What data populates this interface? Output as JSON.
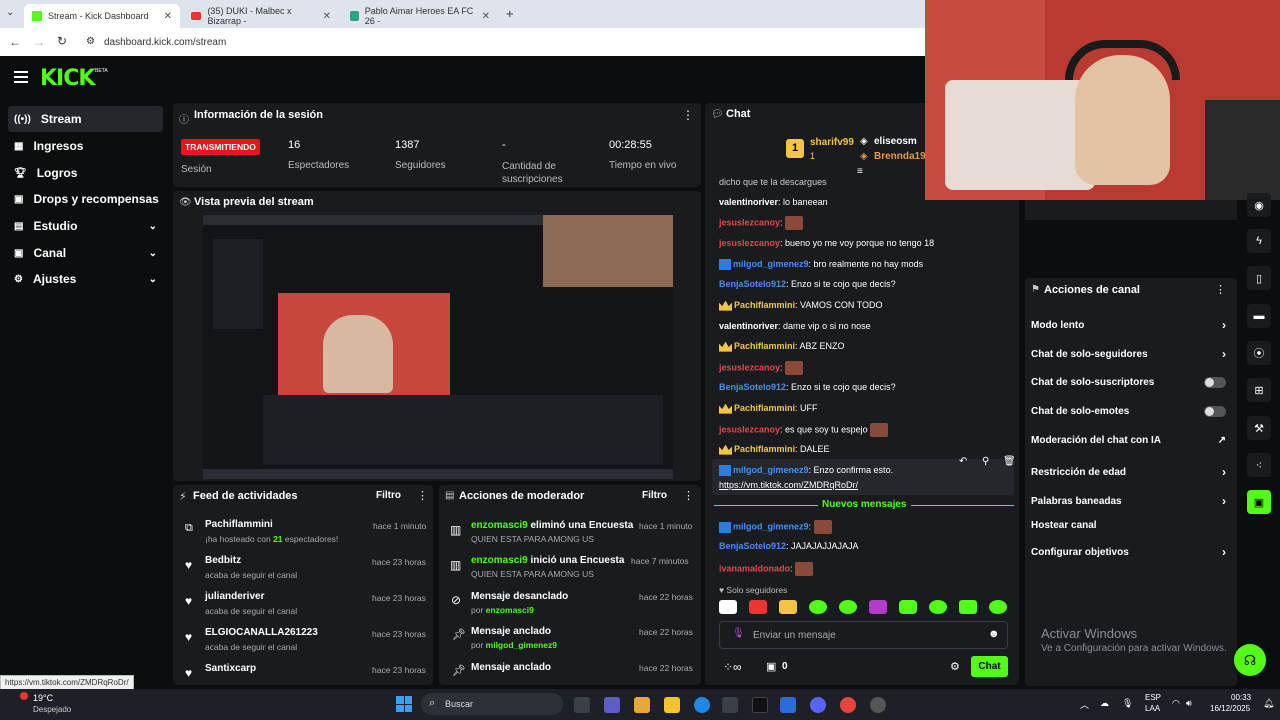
{
  "browser": {
    "tabs": [
      {
        "title": "Stream - Kick Dashboard",
        "active": true
      },
      {
        "title": "(35) DUKI - Malbec x Bizarrap -",
        "active": false
      },
      {
        "title": "Pablo Aimar Heroes EA FC 26 -",
        "active": false
      }
    ],
    "url": "dashboard.kick.com/stream",
    "status_url": "https://vm.tiktok.com/ZMDRqRoDr/"
  },
  "header": {
    "logo": "KICK",
    "beta": "BETA"
  },
  "sidebar": {
    "items": [
      {
        "label": "Stream",
        "active": true,
        "icon": "broadcast-icon"
      },
      {
        "label": "Ingresos",
        "icon": "chart-icon"
      },
      {
        "label": "Logros",
        "icon": "trophy-icon"
      },
      {
        "label": "Drops y recompensas",
        "icon": "gift-icon"
      },
      {
        "label": "Estudio",
        "icon": "studio-icon",
        "chevron": "⌄"
      },
      {
        "label": "Canal",
        "icon": "channel-icon",
        "chevron": "⌄"
      },
      {
        "label": "Ajustes",
        "icon": "gear-icon",
        "chevron": "⌄"
      }
    ]
  },
  "session": {
    "title": "Información de la sesión",
    "live_badge": "TRANSMITIENDO",
    "session_label": "Sesión",
    "stats": [
      {
        "value": "16",
        "label": "Espectadores"
      },
      {
        "value": "1387",
        "label": "Seguidores"
      },
      {
        "value": "-",
        "label": "Cantidad de suscripciones"
      },
      {
        "value": "00:28:55",
        "label": "Tiempo en vivo"
      }
    ]
  },
  "preview": {
    "title": "Vista previa del stream"
  },
  "feed": {
    "title": "Feed de actividades",
    "filter": "Filtro",
    "items": [
      {
        "name": "Pachiflammini",
        "sub_pre": "¡ha hosteado con ",
        "sub_num": "21",
        "sub_post": " espectadores!",
        "time": "hace 1 minuto",
        "icon": "host-icon"
      },
      {
        "name": "Bedbitz",
        "sub": "acaba de seguir el canal",
        "time": "hace 23 horas",
        "icon": "heart-icon"
      },
      {
        "name": "julianderiver",
        "sub": "acaba de seguir el canal",
        "time": "hace 23 horas",
        "icon": "heart-icon"
      },
      {
        "name": "ELGIOCANALLA261223",
        "sub": "acaba de seguir el canal",
        "time": "hace 23 horas",
        "icon": "heart-icon"
      },
      {
        "name": "Santixcarp",
        "sub": "",
        "time": "hace 23 horas",
        "icon": "heart-icon"
      }
    ]
  },
  "modactions": {
    "title": "Acciones de moderador",
    "filter": "Filtro",
    "items": [
      {
        "user": "enzomasci9",
        "action": " eliminó una Encuesta",
        "sub": "QUIEN ESTA PARA AMONG US",
        "time": "hace 1 minuto",
        "icon": "poll-icon"
      },
      {
        "user": "enzomasci9",
        "action": " inició una Encuesta",
        "sub": "QUIEN ESTA PARA AMONG US",
        "time": "hace 7 minutos",
        "icon": "poll-icon"
      },
      {
        "title": "Mensaje desanclado",
        "by_pre": "por ",
        "by": "enzomasci9",
        "time": "hace 22 horas",
        "icon": "unpin-icon"
      },
      {
        "title": "Mensaje anclado",
        "by_pre": "por ",
        "by": "milgod_gimenez9",
        "time": "hace 22 horas",
        "icon": "pin-icon"
      },
      {
        "title": "Mensaje anclado",
        "time": "hace 22 horas",
        "icon": "pin-icon"
      }
    ]
  },
  "chat": {
    "title": "Chat",
    "top": {
      "rank1": "sharifv99",
      "rank1_sub": "1",
      "rank2": "eliseosm",
      "rank3": "Brennda19"
    },
    "cut_line": "dicho que te la descargues",
    "messages": [
      {
        "user": "valentinoriver",
        "text": " lo baneean",
        "badge": "",
        "color": "white"
      },
      {
        "user": "jesuslezcanoy",
        "text": "",
        "badge": "",
        "color": "red",
        "emote": true
      },
      {
        "user": "jesuslezcanoy",
        "text": " bueno yo me voy porque no tengo 18",
        "badge": "",
        "color": "red"
      },
      {
        "user": "milgod_gimenez9",
        "text": " bro realmente no hay mods",
        "badge": "mod",
        "color": "blue"
      },
      {
        "user": "BenjaSotelo912",
        "text": " Enzo si te cojo que decis?",
        "badge": "",
        "color": "blue"
      },
      {
        "user": "Pachiflammini",
        "text": " VAMOS CON TODO",
        "badge": "crown",
        "color": "gold"
      },
      {
        "user": "valentinoriver",
        "text": " dame vip o si no nose",
        "badge": "",
        "color": "white"
      },
      {
        "user": "Pachiflammini",
        "text": " ABZ ENZO",
        "badge": "crown",
        "color": "gold"
      },
      {
        "user": "jesuslezcanoy",
        "text": "",
        "badge": "",
        "color": "red",
        "emote": true
      },
      {
        "user": "BenjaSotelo912",
        "text": " Enzo si te cojo que decis?",
        "badge": "",
        "color": "blue"
      },
      {
        "user": "Pachiflammini",
        "text": " UFF",
        "badge": "crown",
        "color": "gold"
      },
      {
        "user": "jesuslezcanoy",
        "text": " es que soy tu espejo",
        "badge": "",
        "color": "red",
        "emote": true
      },
      {
        "user": "Pachiflammini",
        "text": " DALEE",
        "badge": "crown",
        "color": "gold"
      },
      {
        "user": "milgod_gimenez9",
        "text": " Enzo confirma esto.",
        "badge": "mod",
        "color": "blue"
      }
    ],
    "link": "https://vm.tiktok.com/ZMDRqRoDr/",
    "new_messages": "Nuevos mensajes",
    "after": [
      {
        "user": "milgod_gimenez9",
        "text": "",
        "badge": "mod",
        "color": "blue",
        "emote": true
      },
      {
        "user": "BenjaSotelo912",
        "text": " JAJAJAJJAJAJA",
        "badge": "",
        "color": "blue"
      },
      {
        "user": "ivanamaldonado",
        "text": "",
        "badge": "",
        "color": "red",
        "emote": true
      }
    ],
    "followers_only": "Solo seguidores",
    "input_placeholder": "Enviar un mensaje",
    "count": "0",
    "send": "Chat"
  },
  "channel_actions": {
    "title": "Acciones de canal",
    "items": [
      {
        "label": "Modo lento",
        "control": "chevron"
      },
      {
        "label": "Chat de solo-seguidores",
        "control": "chevron"
      },
      {
        "label": "Chat de solo-suscriptores",
        "control": "toggle"
      },
      {
        "label": "Chat de solo-emotes",
        "control": "toggle"
      },
      {
        "label": "Moderación del chat con IA",
        "control": "external"
      },
      {
        "label": "Restricción de edad",
        "control": "chevron"
      },
      {
        "label": "Palabras baneadas",
        "control": "chevron"
      },
      {
        "label": "Hostear canal",
        "control": "none"
      },
      {
        "label": "Configurar objetivos",
        "control": "chevron"
      }
    ]
  },
  "windows": {
    "activate_title": "Activar Windows",
    "activate_sub": "Ve a Configuración para activar Windows."
  },
  "taskbar": {
    "weather_temp": "19°C",
    "weather_desc": "Despejado",
    "search": "Buscar",
    "lang1": "ESP",
    "lang2": "LAA",
    "time": "00:33",
    "date": "16/12/2025"
  },
  "colors": {
    "kick_green": "#53fc18",
    "live_red": "#e8151b"
  }
}
